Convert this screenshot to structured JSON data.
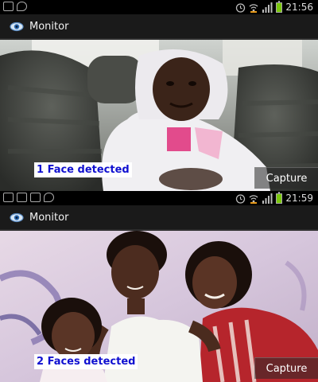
{
  "screens": [
    {
      "status_time": "21:56",
      "app_title": "Monitor",
      "detection_label": "1 Face detected",
      "capture_label": "Capture"
    },
    {
      "status_time": "21:59",
      "app_title": "Monitor",
      "detection_label": "2 Faces detected",
      "capture_label": "Capture"
    }
  ],
  "icons": {
    "app": "eye-icon",
    "status_left_1": [
      "chat-notification-icon",
      "message-bubble-icon"
    ],
    "status_left_2": [
      "gmail-icon",
      "gallery-icon",
      "chat-notification-icon",
      "message-bubble-icon"
    ],
    "status_right": [
      "alarm-icon",
      "wifi-icon",
      "signal-icon",
      "battery-icon"
    ]
  },
  "colors": {
    "detection_text": "#1010d0",
    "battery": "#7ac70c"
  }
}
